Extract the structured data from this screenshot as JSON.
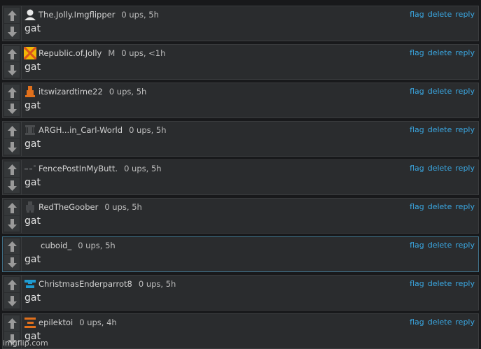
{
  "comments": [
    {
      "user": "The.Jolly.Imgflipper",
      "avatar_icon": "person-silhouette-icon",
      "stats": "0 ups, 5h",
      "text": "gat",
      "actions": {
        "flag": "flag",
        "delete": "delete",
        "reply": "reply"
      }
    },
    {
      "user": "Republic.of.Jolly",
      "mod": "M",
      "avatar_icon": "yellow-x-flag-icon",
      "stats": "0 ups, <1h",
      "text": "gat",
      "actions": {
        "flag": "flag",
        "delete": "delete",
        "reply": "reply"
      }
    },
    {
      "user": "itswizardtime22",
      "avatar_icon": "orange-wizard-icon",
      "stats": "0 ups, 5h",
      "text": "gat",
      "actions": {
        "flag": "flag",
        "delete": "delete",
        "reply": "reply"
      }
    },
    {
      "user": "ARGH...in_Carl-World",
      "avatar_icon": "dark-figure-icon",
      "stats": "0 ups, 5h",
      "text": "gat",
      "actions": {
        "flag": "flag",
        "delete": "delete",
        "reply": "reply"
      }
    },
    {
      "user": "FencePostInMyButt.",
      "avatar_icon": "dark-dots-icon",
      "stats": "0 ups, 5h",
      "text": "gat",
      "actions": {
        "flag": "flag",
        "delete": "delete",
        "reply": "reply"
      }
    },
    {
      "user": "RedTheGoober",
      "avatar_icon": "dark-figure-icon",
      "stats": "0 ups, 5h",
      "text": "gat",
      "actions": {
        "flag": "flag",
        "delete": "delete",
        "reply": "reply"
      }
    },
    {
      "user": "cuboid_",
      "avatar_icon": "blank-avatar-icon",
      "stats": "0 ups, 5h",
      "text": "gat",
      "actions": {
        "flag": "flag",
        "delete": "delete",
        "reply": "reply"
      }
    },
    {
      "user": "ChristmasEnderparrot8",
      "avatar_icon": "blue-block-icon",
      "stats": "0 ups, 5h",
      "text": "gat",
      "actions": {
        "flag": "flag",
        "delete": "delete",
        "reply": "reply"
      }
    },
    {
      "user": "epilektoi",
      "avatar_icon": "orange-bars-icon",
      "stats": "0 ups, 4h",
      "text": "gat",
      "actions": {
        "flag": "flag",
        "delete": "delete",
        "reply": "reply"
      }
    }
  ],
  "watermark": "imgflip.com",
  "colors": {
    "background": "#18191b",
    "card": "#2a2c2e",
    "link": "#3aa6e0",
    "highlight_border": "#3f6f86"
  }
}
